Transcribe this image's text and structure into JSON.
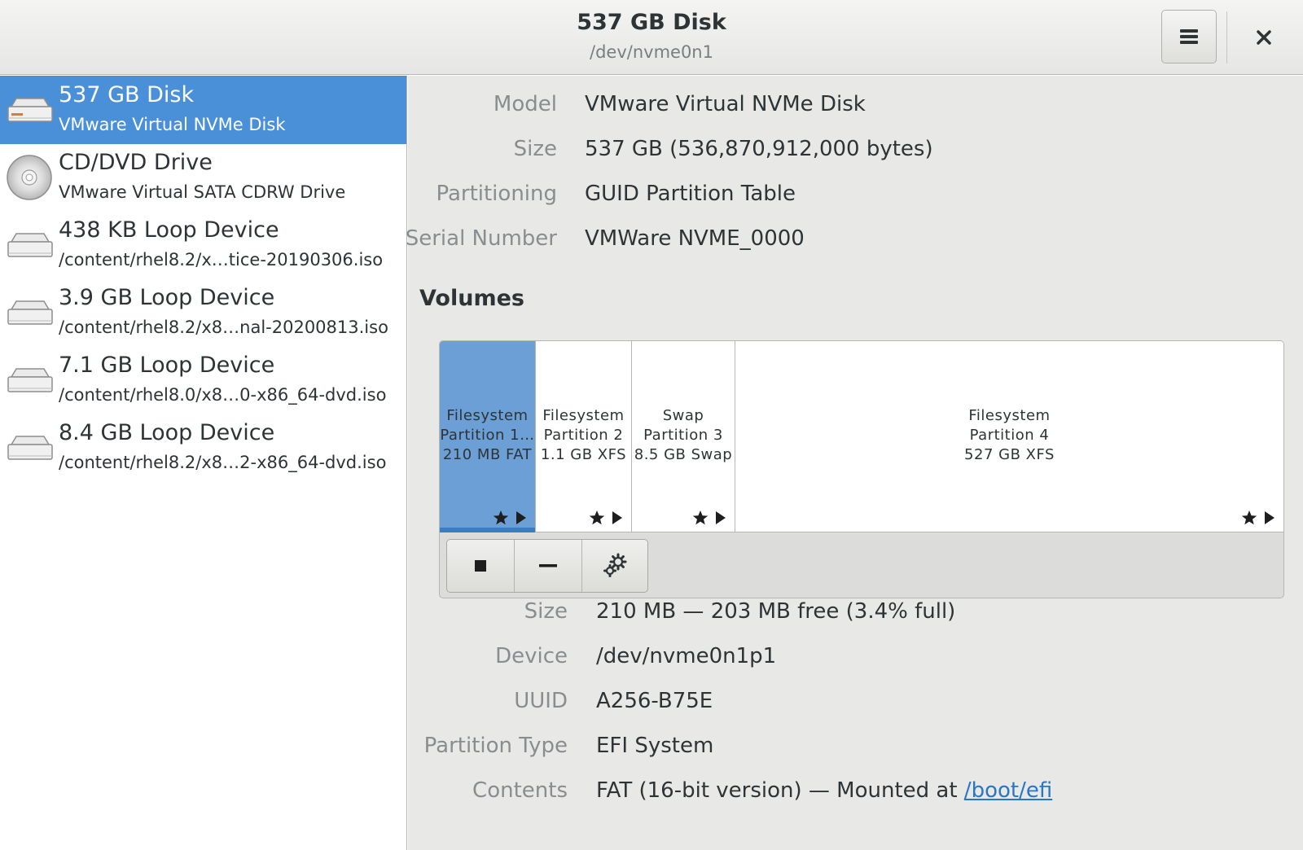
{
  "header": {
    "title": "537 GB Disk",
    "subtitle": "/dev/nvme0n1",
    "menu_icon": "hamburger-menu-icon",
    "close_icon": "close-icon"
  },
  "sidebar": {
    "items": [
      {
        "name": "537 GB Disk",
        "sub": "VMware Virtual NVMe Disk",
        "icon": "hard-disk-icon",
        "selected": true
      },
      {
        "name": "CD/DVD Drive",
        "sub": "VMware Virtual SATA CDRW Drive",
        "icon": "optical-disc-icon",
        "selected": false
      },
      {
        "name": "438 KB Loop Device",
        "sub": "/content/rhel8.2/x…tice-20190306.iso",
        "icon": "hard-disk-icon",
        "selected": false
      },
      {
        "name": "3.9 GB Loop Device",
        "sub": "/content/rhel8.2/x8…nal-20200813.iso",
        "icon": "hard-disk-icon",
        "selected": false
      },
      {
        "name": "7.1 GB Loop Device",
        "sub": "/content/rhel8.0/x8…0-x86_64-dvd.iso",
        "icon": "hard-disk-icon",
        "selected": false
      },
      {
        "name": "8.4 GB Loop Device",
        "sub": "/content/rhel8.2/x8…2-x86_64-dvd.iso",
        "icon": "hard-disk-icon",
        "selected": false
      }
    ]
  },
  "disk_info": {
    "model_label": "Model",
    "model": "VMware Virtual NVMe Disk",
    "size_label": "Size",
    "size": "537 GB (536,870,912,000 bytes)",
    "partitioning_label": "Partitioning",
    "partitioning": "GUID Partition Table",
    "serial_label": "Serial Number",
    "serial": "VMWare NVME_0000"
  },
  "volumes": {
    "heading": "Volumes",
    "segments": [
      {
        "line1": "Filesystem",
        "line2": "Partition 1…",
        "line3": "210 MB FAT",
        "selected": true
      },
      {
        "line1": "Filesystem",
        "line2": "Partition 2",
        "line3": "1.1 GB XFS",
        "selected": false
      },
      {
        "line1": "Swap",
        "line2": "Partition 3",
        "line3": "8.5 GB Swap",
        "selected": false
      },
      {
        "line1": "Filesystem",
        "line2": "Partition 4",
        "line3": "527 GB XFS",
        "selected": false
      }
    ],
    "toolbar_icons": [
      "stop-icon",
      "minus-icon",
      "gear-icon"
    ]
  },
  "partition_info": {
    "size_label": "Size",
    "size": "210 MB — 203 MB free (3.4% full)",
    "device_label": "Device",
    "device": "/dev/nvme0n1p1",
    "uuid_label": "UUID",
    "uuid": "A256-B75E",
    "type_label": "Partition Type",
    "type": "EFI System",
    "contents_label": "Contents",
    "contents_prefix": "FAT (16-bit version) — Mounted at ",
    "mount_link": "/boot/efi"
  },
  "colors": {
    "selection": "#4a90d9",
    "segment_selected": "#6b9fd6",
    "link": "#2a76c6"
  }
}
